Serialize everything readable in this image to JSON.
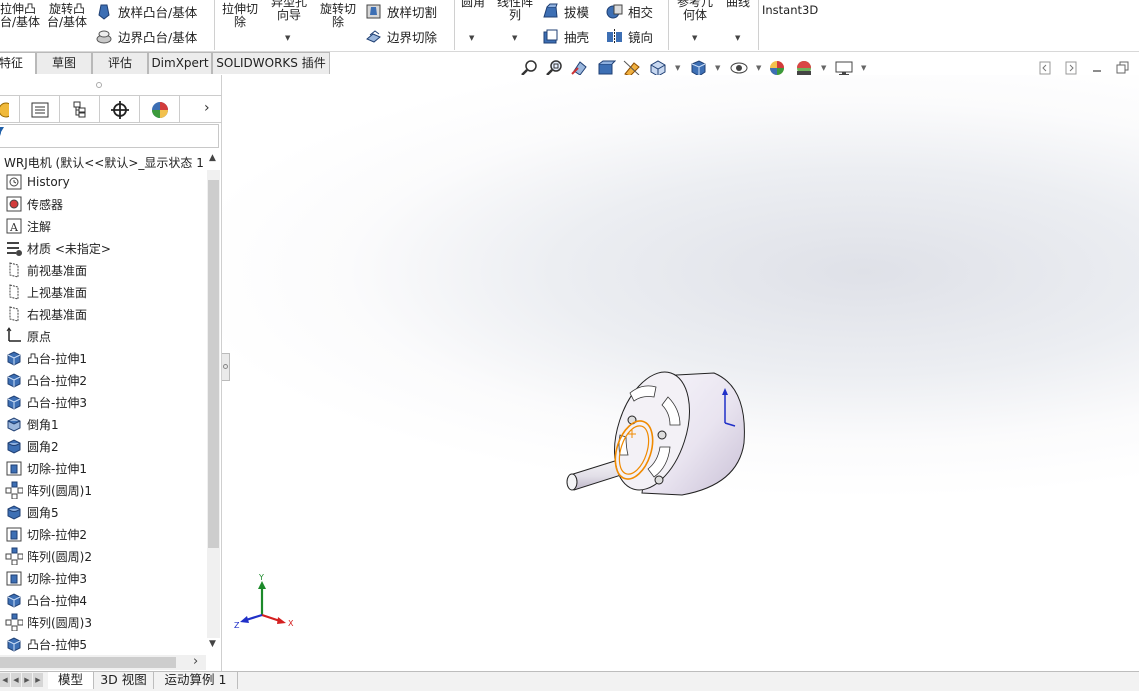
{
  "ribbon": {
    "extrude_boss": [
      "拉伸凸",
      "台/基体"
    ],
    "revolve_boss": [
      "旋转凸",
      "台/基体"
    ],
    "loft_boss": "放样凸台/基体",
    "boundary_boss": "边界凸台/基体",
    "extrude_cut": [
      "拉伸切",
      "除"
    ],
    "hole_wizard": [
      "异型孔",
      "向导"
    ],
    "revolve_cut": [
      "旋转切",
      "除"
    ],
    "loft_cut": "放样切割",
    "boundary_cut": "边界切除",
    "fillet": "圆角",
    "linear_pattern": [
      "线性阵",
      "列"
    ],
    "draft": "拔模",
    "shell": "抽壳",
    "intersect": "相交",
    "mirror": "镜向",
    "ref_geometry": [
      "参考几",
      "何体"
    ],
    "curves": "曲线",
    "instant3d": "Instant3D"
  },
  "command_tabs": [
    "特征",
    "草图",
    "评估",
    "DimXpert",
    "SOLIDWORKS 插件"
  ],
  "tree": {
    "root": "WRJ电机 (默认<<默认>_显示状态 1",
    "items": [
      {
        "label": "History",
        "icon": "history-icon"
      },
      {
        "label": "传感器",
        "icon": "sensor-icon"
      },
      {
        "label": "注解",
        "icon": "annotation-icon"
      },
      {
        "label": "材质 <未指定>",
        "icon": "material-icon"
      },
      {
        "label": "前视基准面",
        "icon": "plane-icon"
      },
      {
        "label": "上视基准面",
        "icon": "plane-icon"
      },
      {
        "label": "右视基准面",
        "icon": "plane-icon"
      },
      {
        "label": "原点",
        "icon": "origin-icon"
      },
      {
        "label": "凸台-拉伸1",
        "icon": "boss-extrude-icon"
      },
      {
        "label": "凸台-拉伸2",
        "icon": "boss-extrude-icon"
      },
      {
        "label": "凸台-拉伸3",
        "icon": "boss-extrude-icon"
      },
      {
        "label": "倒角1",
        "icon": "chamfer-icon"
      },
      {
        "label": "圆角2",
        "icon": "fillet-icon"
      },
      {
        "label": "切除-拉伸1",
        "icon": "cut-extrude-icon"
      },
      {
        "label": "阵列(圆周)1",
        "icon": "circular-pattern-icon"
      },
      {
        "label": "圆角5",
        "icon": "fillet-icon"
      },
      {
        "label": "切除-拉伸2",
        "icon": "cut-extrude-icon"
      },
      {
        "label": "阵列(圆周)2",
        "icon": "circular-pattern-icon"
      },
      {
        "label": "切除-拉伸3",
        "icon": "cut-extrude-icon"
      },
      {
        "label": "凸台-拉伸4",
        "icon": "boss-extrude-icon"
      },
      {
        "label": "阵列(圆周)3",
        "icon": "circular-pattern-icon"
      },
      {
        "label": "凸台-拉伸5",
        "icon": "boss-extrude-icon"
      }
    ]
  },
  "bottom_tabs": [
    "模型",
    "3D 视图",
    "运动算例 1"
  ],
  "triad": {
    "x": "X",
    "y": "Y",
    "z": "Z"
  },
  "colors": {
    "accent": "#f08a00",
    "part": "#e6e2ee",
    "axis_x": "#d42020",
    "axis_y": "#1c8a2a",
    "axis_z": "#2030c8"
  }
}
